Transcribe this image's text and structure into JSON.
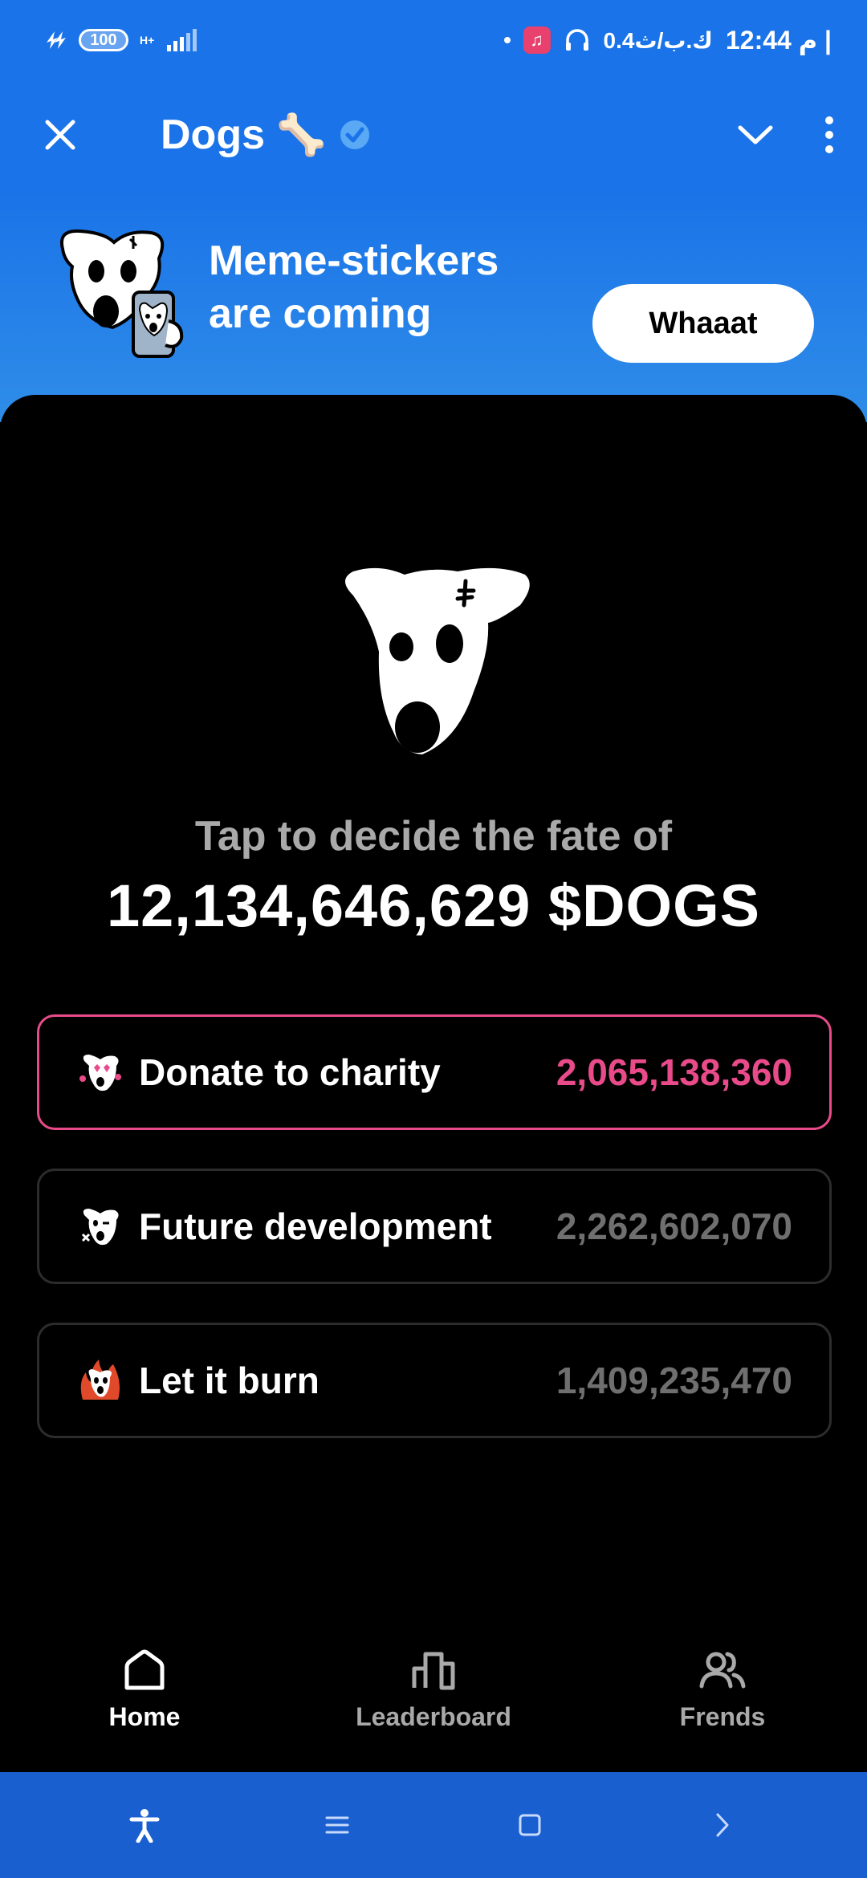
{
  "status_bar": {
    "battery": "100",
    "network": "H+",
    "speed": "0.4ك.ب/ث",
    "time": "12:44 م |"
  },
  "header": {
    "title": "Dogs",
    "title_emoji": "🦴"
  },
  "banner": {
    "line1": "Meme-stickers",
    "line2": "are coming",
    "button_label": "Whaaat"
  },
  "main": {
    "tap_label": "Tap to decide the fate of",
    "total_amount": "12,134,646,629",
    "token": "$DOGS",
    "options": [
      {
        "label": "Donate to charity",
        "value": "2,065,138,360",
        "selected": true
      },
      {
        "label": "Future development",
        "value": "2,262,602,070",
        "selected": false
      },
      {
        "label": "Let it burn",
        "value": "1,409,235,470",
        "selected": false
      }
    ]
  },
  "nav": {
    "home": "Home",
    "leaderboard": "Leaderboard",
    "friends": "Frends"
  },
  "colors": {
    "brand_blue": "#1a73e8",
    "accent_pink": "#e94b8a",
    "muted_gray": "#6f6f6f"
  }
}
